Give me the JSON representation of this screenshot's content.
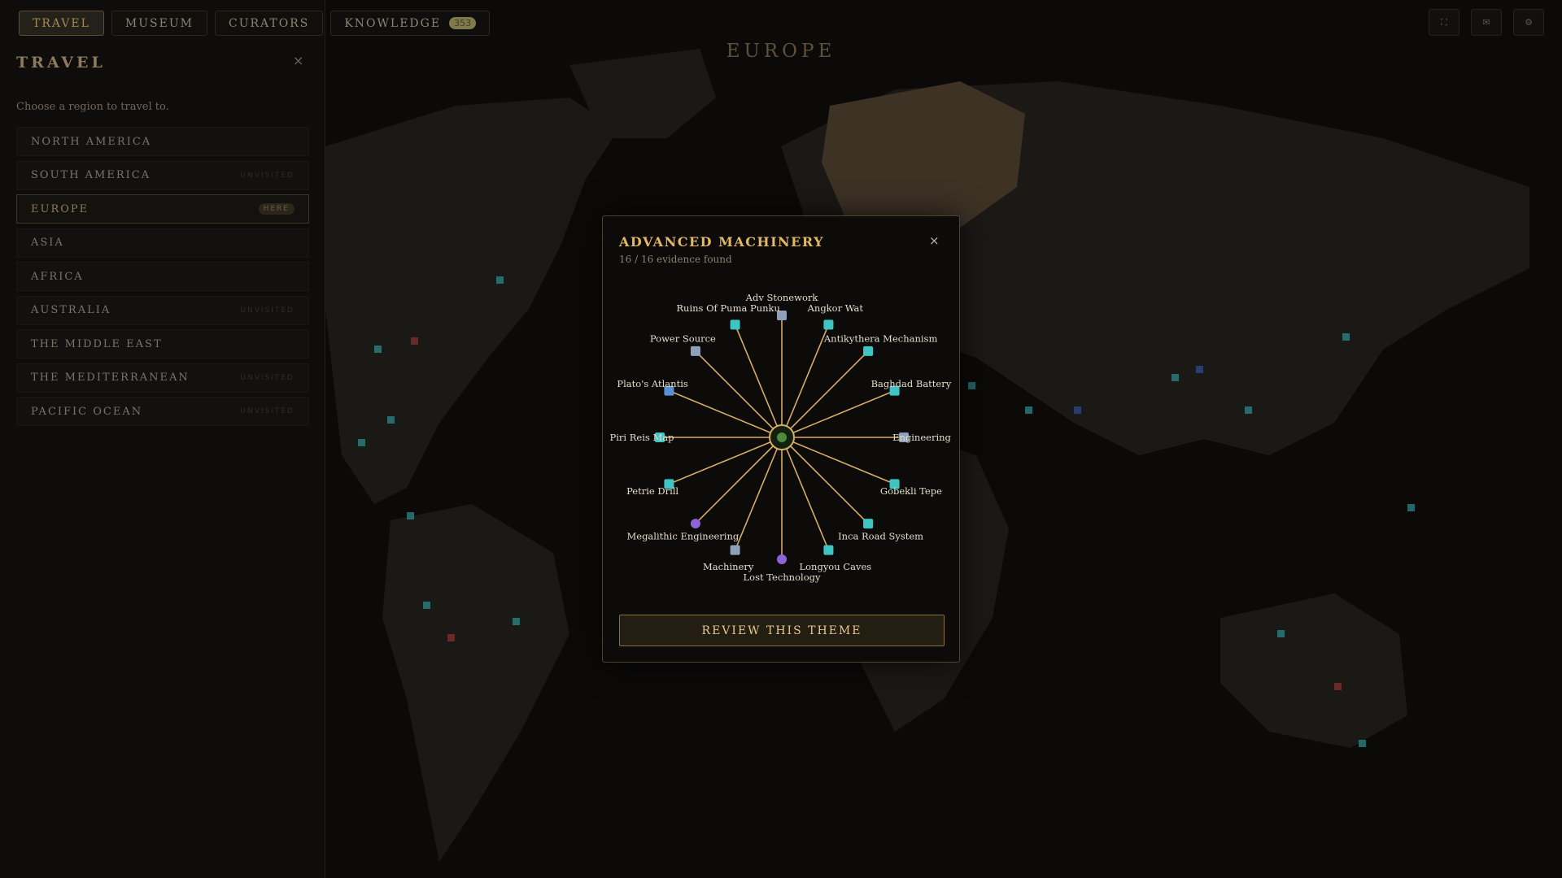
{
  "nav": {
    "tabs": [
      {
        "label": "TRAVEL",
        "active": true
      },
      {
        "label": "MUSEUM",
        "active": false
      },
      {
        "label": "CURATORS",
        "active": false
      },
      {
        "label": "KNOWLEDGE",
        "badge": "353",
        "active": false
      }
    ],
    "icons": [
      "fullscreen-icon",
      "mail-icon",
      "gear-icon"
    ],
    "icon_glyphs": [
      "⛶",
      "✉",
      "⚙"
    ]
  },
  "region_title": "EUROPE",
  "panel": {
    "title": "TRAVEL",
    "close": "×",
    "subtitle": "Choose a region to travel to.",
    "regions": [
      {
        "name": "NORTH AMERICA",
        "status": ""
      },
      {
        "name": "SOUTH AMERICA",
        "status": "UNVISITED"
      },
      {
        "name": "EUROPE",
        "status": "HERE",
        "current": true
      },
      {
        "name": "ASIA",
        "status": ""
      },
      {
        "name": "AFRICA",
        "status": ""
      },
      {
        "name": "AUSTRALIA",
        "status": "UNVISITED"
      },
      {
        "name": "THE MIDDLE EAST",
        "status": ""
      },
      {
        "name": "THE MEDITERRANEAN",
        "status": "UNVISITED"
      },
      {
        "name": "PACIFIC OCEAN",
        "status": "UNVISITED"
      }
    ]
  },
  "modal": {
    "title": "ADVANCED MACHINERY",
    "close": "×",
    "subtitle": "16 / 16 evidence found",
    "button": "REVIEW THIS THEME",
    "nodes": [
      {
        "label": "Adv Stonework",
        "icon": "tools-icon",
        "color": "#8fa0b8"
      },
      {
        "label": "Angkor Wat",
        "icon": "site-icon",
        "color": "#3fc4c4"
      },
      {
        "label": "Antikythera Mechanism",
        "icon": "artifact-icon",
        "color": "#3fc4c4"
      },
      {
        "label": "Baghdad Battery",
        "icon": "artifact-icon",
        "color": "#3fc4c4"
      },
      {
        "label": "Engineering",
        "icon": "tools-icon",
        "color": "#8fa0b8"
      },
      {
        "label": "Gobekli Tepe",
        "icon": "site-icon",
        "color": "#3fc4c4"
      },
      {
        "label": "Inca Road System",
        "icon": "site-icon",
        "color": "#3fc4c4"
      },
      {
        "label": "Longyou Caves",
        "icon": "site-icon",
        "color": "#3fc4c4"
      },
      {
        "label": "Lost Technology",
        "icon": "eye-icon",
        "color": "#8f63d8"
      },
      {
        "label": "Machinery",
        "icon": "tools-icon",
        "color": "#8fa0b8"
      },
      {
        "label": "Megalithic Engineering",
        "icon": "eye-icon",
        "color": "#8f63d8"
      },
      {
        "label": "Petrie Drill",
        "icon": "artifact-icon",
        "color": "#3fc4c4"
      },
      {
        "label": "Piri Reis Map",
        "icon": "artifact-icon",
        "color": "#3fc4c4"
      },
      {
        "label": "Plato's Atlantis",
        "icon": "book-icon",
        "color": "#5b8fd8"
      },
      {
        "label": "Power Source",
        "icon": "tools-icon",
        "color": "#8fa0b8"
      },
      {
        "label": "Ruins Of Puma Punku",
        "icon": "site-icon",
        "color": "#3fc4c4"
      }
    ],
    "line_color": "#d6ad63",
    "hub_color": "#4f8a3f"
  },
  "map_colors": {
    "land": "#1c1a17",
    "ocean": "#0b0a09",
    "highlight": "#4a3c2b"
  }
}
